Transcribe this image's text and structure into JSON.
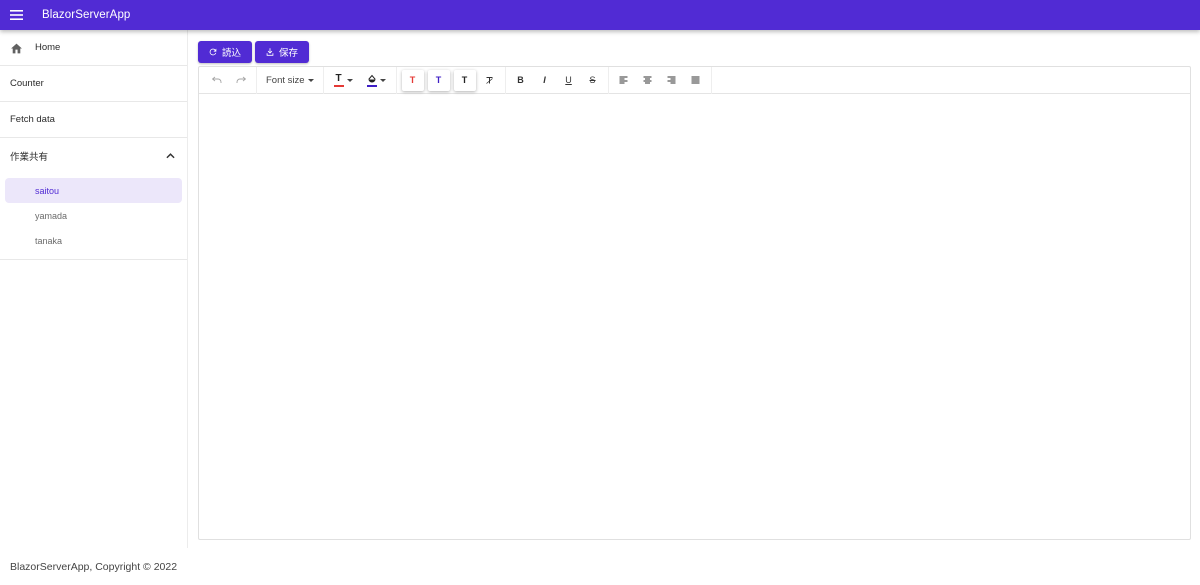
{
  "app": {
    "title": "BlazorServerApp"
  },
  "nav": {
    "items": [
      {
        "label": "Home",
        "icon": "home-icon"
      },
      {
        "label": "Counter"
      },
      {
        "label": "Fetch data"
      }
    ],
    "group": {
      "label": "作業共有",
      "expanded": true,
      "items": [
        {
          "label": "saitou",
          "active": true
        },
        {
          "label": "yamada",
          "active": false
        },
        {
          "label": "tanaka",
          "active": false
        }
      ]
    }
  },
  "actions": {
    "load_label": "読込",
    "save_label": "保存"
  },
  "editor": {
    "font_size_label": "Font size",
    "text_color": "#e53935",
    "highlight_color": "#3f1fc5",
    "content": ""
  },
  "colors": {
    "primary": "#512bd4",
    "active_bg": "#ece7fa"
  },
  "footer": {
    "text": "BlazorServerApp, Copyright © 2022"
  }
}
